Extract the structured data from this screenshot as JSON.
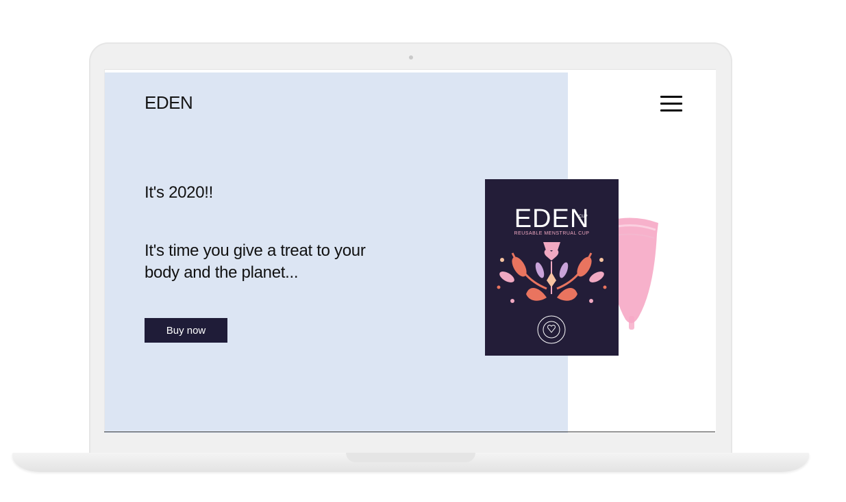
{
  "site": {
    "brand": "EDEN",
    "menu_icon": "hamburger-menu-icon"
  },
  "hero": {
    "headline": "It's 2020!!",
    "subline": "It's time you give a treat to your body and the planet...",
    "cta_label": "Buy now"
  },
  "product": {
    "package_brand": "EDEN",
    "package_cup_tag": "CUP",
    "package_subtitle": "REUSABLE MENSTRUAL CUP",
    "seal_text": "PLANET THE EDEN CUP PROMISE TO YOU & THE"
  },
  "colors": {
    "hero_background": "#dce5f3",
    "button_background": "#1f1c38",
    "package_background": "#231d38",
    "cup_pink": "#f6a9c5",
    "accent_coral": "#e9745f",
    "accent_pink": "#f1a9c2"
  }
}
